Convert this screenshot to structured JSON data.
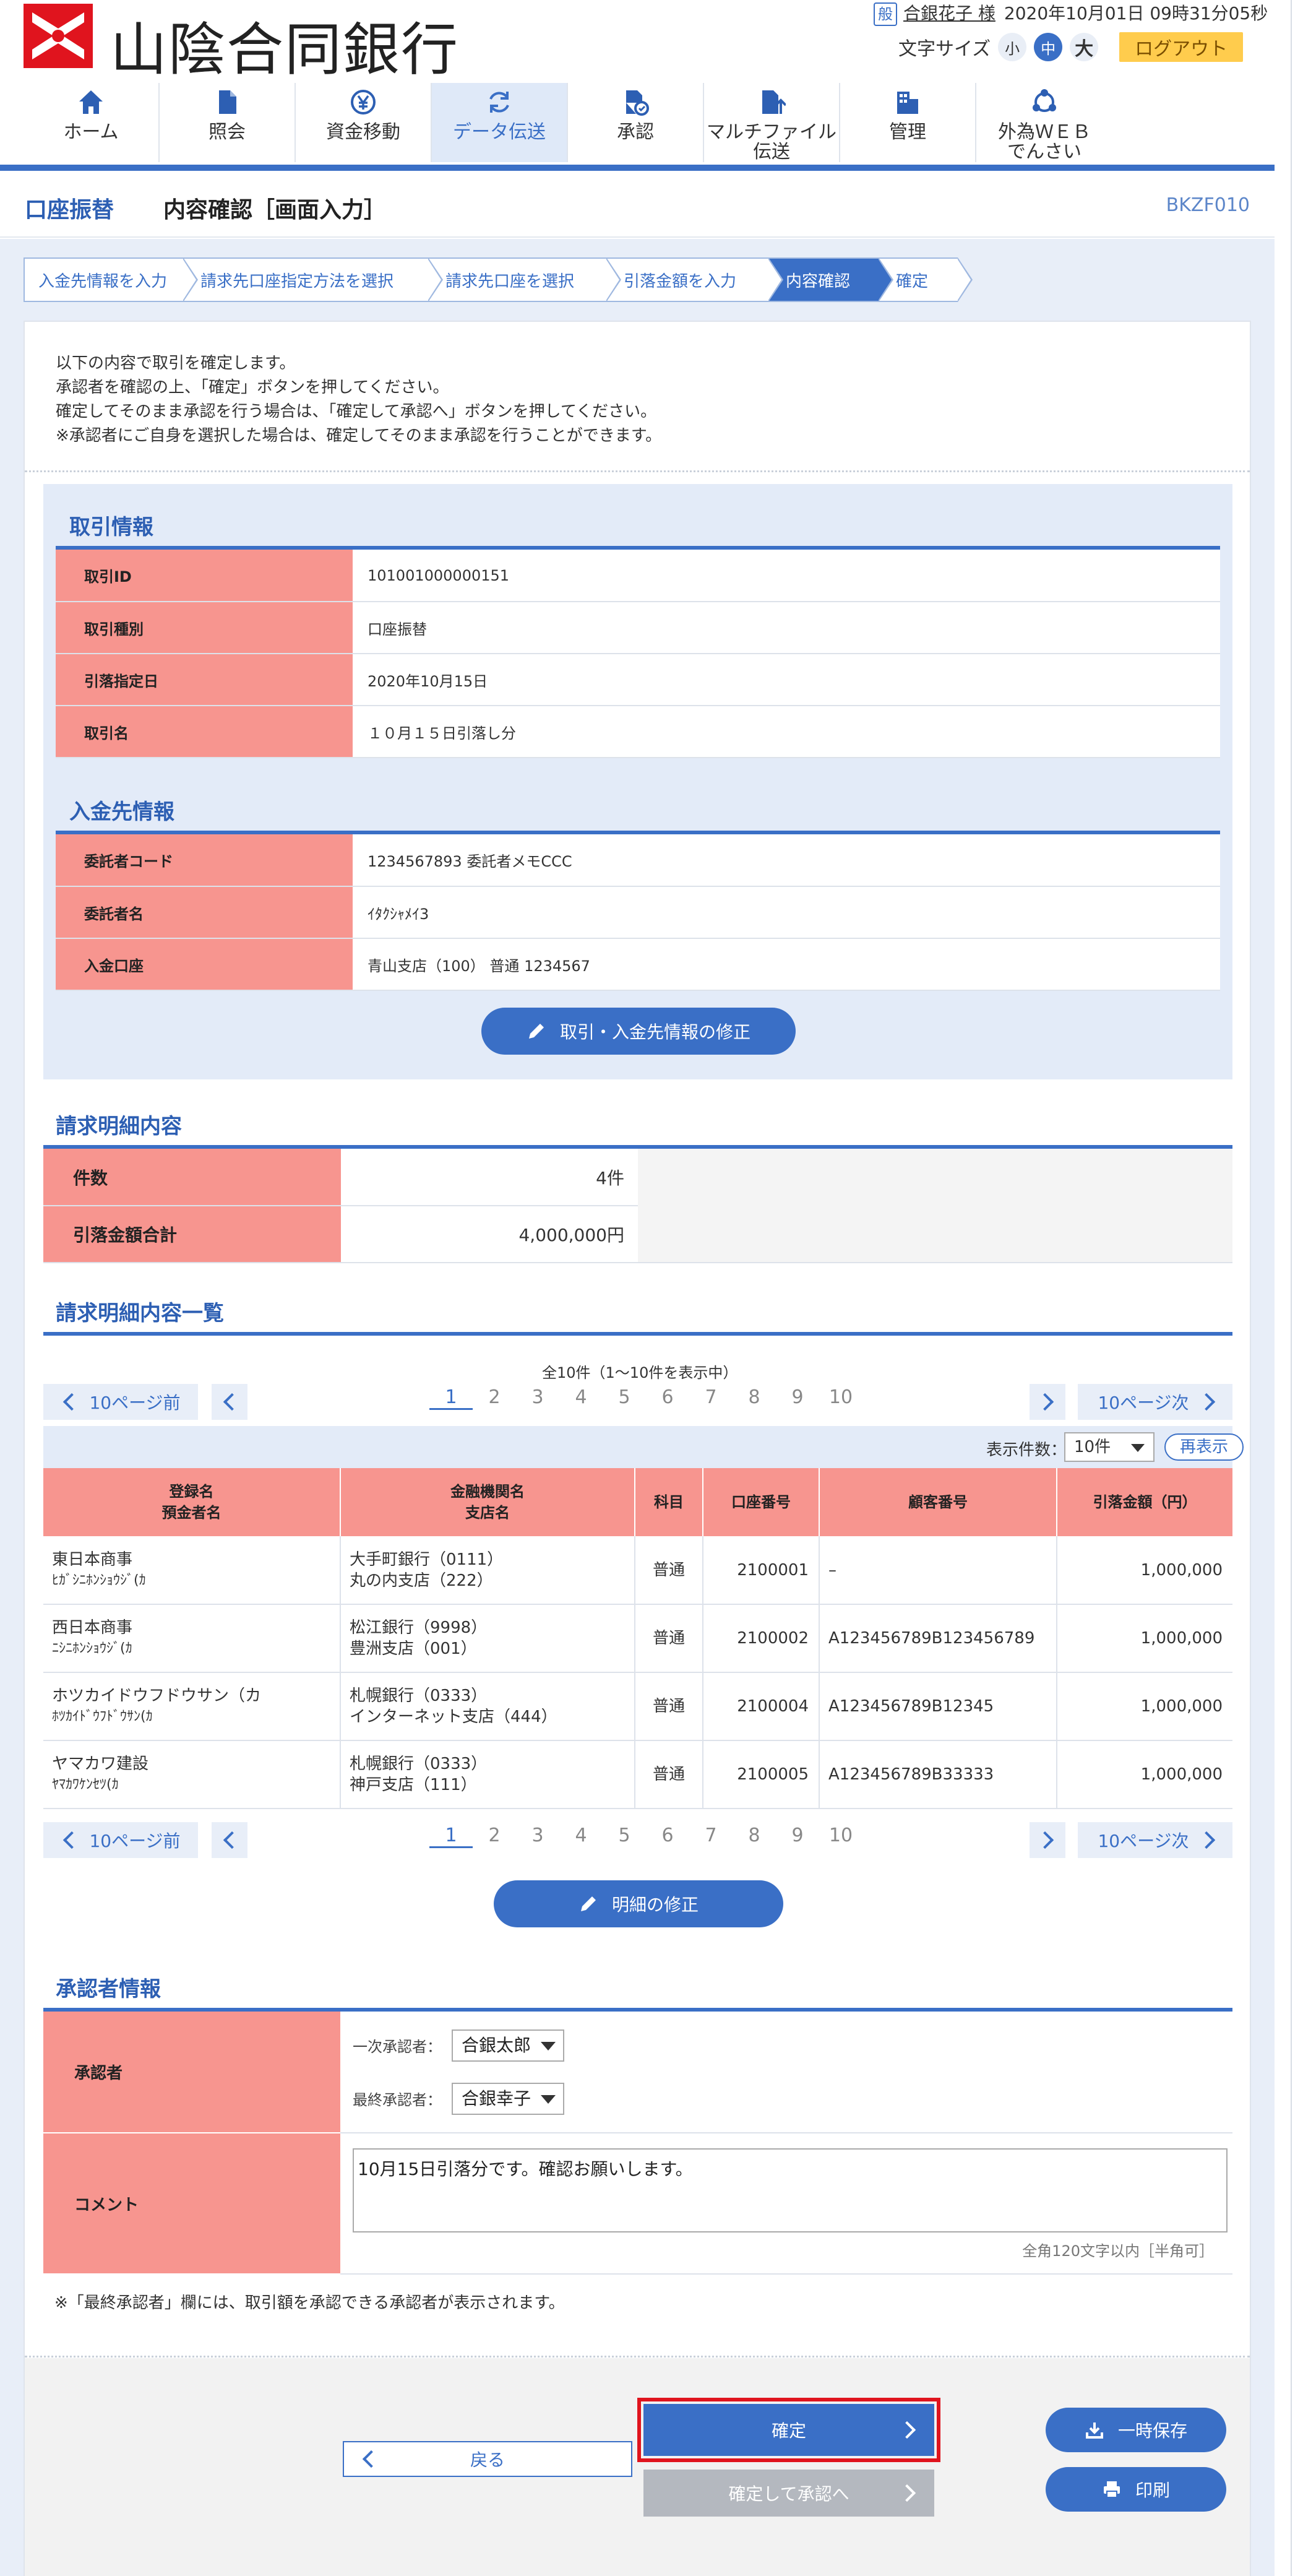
{
  "header": {
    "bank_name": "山陰合同銀行",
    "user_badge": "般",
    "user_name": "合銀花子 様",
    "datetime": "2020年10月01日 09時31分05秒",
    "fontsize_label": "文字サイズ",
    "fontsize_small": "小",
    "fontsize_medium": "中",
    "fontsize_large": "大",
    "logout": "ログアウト"
  },
  "nav": [
    {
      "label": "ホーム",
      "icon": "home-icon"
    },
    {
      "label": "照会",
      "icon": "document-icon"
    },
    {
      "label": "資金移動",
      "icon": "yen-transfer-icon"
    },
    {
      "label": "データ伝送",
      "icon": "refresh-icon"
    },
    {
      "label": "承認",
      "icon": "approval-icon"
    },
    {
      "label": "マルチファイル\n伝送",
      "icon": "file-upload-icon"
    },
    {
      "label": "管理",
      "icon": "management-icon"
    },
    {
      "label": "外為ＷＥＢ\nでんさい",
      "icon": "network-icon"
    }
  ],
  "page": {
    "category": "口座振替",
    "title": "内容確認［画面入力］",
    "screen_code": "BKZF010"
  },
  "steps": [
    "入金先情報を入力",
    "請求先口座指定方法を選択",
    "請求先口座を選択",
    "引落金額を入力",
    "内容確認",
    "確定"
  ],
  "intro": [
    "以下の内容で取引を確定します。",
    "承認者を確認の上、「確定」ボタンを押してください。",
    "確定してそのまま承認を行う場合は、「確定して承認へ」ボタンを押してください。",
    "※承認者にご自身を選択した場合は、確定してそのまま承認を行うことができます。"
  ],
  "transaction": {
    "title": "取引情報",
    "rows": [
      {
        "key": "取引ID",
        "value": "101001000000151"
      },
      {
        "key": "取引種別",
        "value": "口座振替"
      },
      {
        "key": "引落指定日",
        "value": "2020年10月15日"
      },
      {
        "key": "取引名",
        "value": "１０月１５日引落し分"
      }
    ]
  },
  "payee": {
    "title": "入金先情報",
    "rows": [
      {
        "key": "委託者コード",
        "value": "1234567893 委託者メモCCC"
      },
      {
        "key": "委託者名",
        "value": "ｲﾀｸｼｬﾒｲ3"
      },
      {
        "key": "入金口座",
        "value": "青山支店（100） 普通 1234567"
      }
    ],
    "edit_button": "取引・入金先情報の修正"
  },
  "billing_summary": {
    "title": "請求明細内容",
    "rows": [
      {
        "key": "件数",
        "value": "4件"
      },
      {
        "key": "引落金額合計",
        "value": "4,000,000円"
      }
    ]
  },
  "billing_list": {
    "title": "請求明細内容一覧",
    "count_text": "全10件（1～10件を表示中）",
    "prev10": "10ページ前",
    "next10": "10ページ次",
    "pages": [
      "1",
      "2",
      "3",
      "4",
      "5",
      "6",
      "7",
      "8",
      "9",
      "10"
    ],
    "current_page": "1",
    "display_label": "表示件数：",
    "display_value": "10件",
    "redisplay": "再表示",
    "headers": {
      "name1": "登録名",
      "name2": "預金者名",
      "bank1": "金融機関名",
      "bank2": "支店名",
      "subject": "科目",
      "account": "口座番号",
      "customer": "顧客番号",
      "amount": "引落金額（円）"
    },
    "rows": [
      {
        "name": "東日本商事",
        "kana": "ﾋｶﾞｼﾆﾎﾝｼｮｳｼﾞ(ｶ",
        "bank": "大手町銀行（0111）",
        "branch": "丸の内支店（222）",
        "subject": "普通",
        "account": "2100001",
        "customer": "–",
        "amount": "1,000,000"
      },
      {
        "name": "西日本商事",
        "kana": "ﾆｼﾆﾎﾝｼｮｳｼﾞ(ｶ",
        "bank": "松江銀行（9998）",
        "branch": "豊洲支店（001）",
        "subject": "普通",
        "account": "2100002",
        "customer": "A123456789B123456789",
        "amount": "1,000,000"
      },
      {
        "name": "ホツカイドウフドウサン（カ",
        "kana": "ﾎﾂｶｲﾄﾞｳﾌﾄﾞｳｻﾝ(ｶ",
        "bank": "札幌銀行（0333）",
        "branch": "インターネット支店（444）",
        "subject": "普通",
        "account": "2100004",
        "customer": "A123456789B12345",
        "amount": "1,000,000"
      },
      {
        "name": "ヤマカワ建設",
        "kana": "ﾔﾏｶﾜｹﾝｾﾂ(ｶ",
        "bank": "札幌銀行（0333）",
        "branch": "神戸支店（111）",
        "subject": "普通",
        "account": "2100005",
        "customer": "A123456789B33333",
        "amount": "1,000,000"
      }
    ],
    "edit_button": "明細の修正"
  },
  "approver": {
    "title": "承認者情報",
    "label": "承認者",
    "first_label": "一次承認者：",
    "first_value": "合銀太郎",
    "final_label": "最終承認者：",
    "final_value": "合銀幸子",
    "comment_label": "コメント",
    "comment_value": "10月15日引落分です。確認お願いします。",
    "char_limit": "全角120文字以内［半角可］",
    "note": "※「最終承認者」欄には、取引額を承認できる承認者が表示されます。"
  },
  "footer": {
    "back": "戻る",
    "confirm": "確定",
    "confirm_approve": "確定して承認へ",
    "temp_save": "一時保存",
    "print": "印刷"
  },
  "colors": {
    "accent": "#3a6fc6",
    "label_bg": "#f7958f",
    "highlight": "#e0141e",
    "logout": "#ffcc4d"
  }
}
